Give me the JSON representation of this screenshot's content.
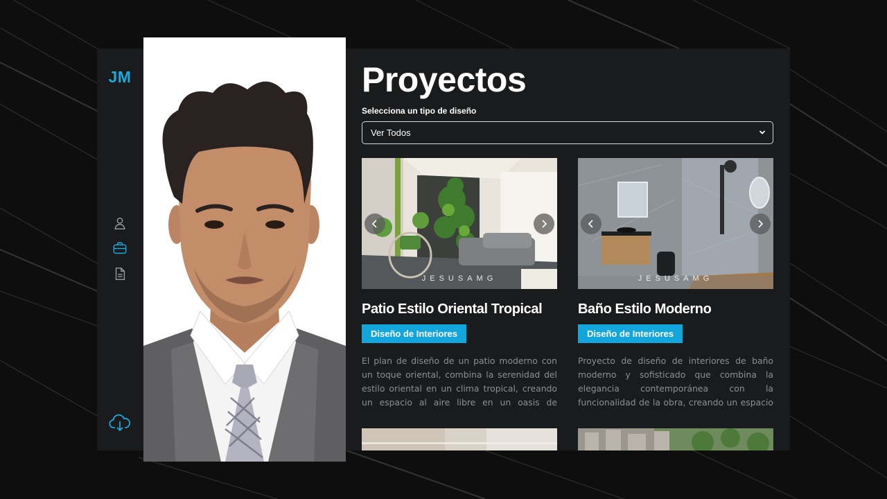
{
  "brand": {
    "initials": "JM",
    "accent": "#1ba8dc"
  },
  "sidebar": {
    "items": [
      {
        "icon": "user-icon",
        "active": false
      },
      {
        "icon": "briefcase-icon",
        "active": true
      },
      {
        "icon": "document-icon",
        "active": false
      }
    ],
    "download_icon": "cloud-download-icon"
  },
  "main": {
    "title": "Proyectos",
    "filter_label": "Selecciona un tipo de diseño",
    "filter_value": "Ver Todos"
  },
  "projects": [
    {
      "title": "Patio Estilo Oriental Tropical",
      "category": "Diseño de Interiores",
      "description": "El plan de diseño de un patio moderno con un toque oriental, combina la serenidad del estilo oriental en un clima tropical, creando un espacio al aire libre en un oasis de tranquilid...",
      "watermark": "JESUSAMG"
    },
    {
      "title": "Baño Estilo Moderno",
      "category": "Diseño de Interiores",
      "description": "Proyecto de diseño de interiores de baño moderno y sofisticado que combina la elegancia contemporánea con la funcionalidad de la obra, creando un espacio que es t...",
      "watermark": "JESUSAMG"
    }
  ],
  "colors": {
    "badge": "#12a6dc",
    "panel": "#1a1b1c"
  }
}
